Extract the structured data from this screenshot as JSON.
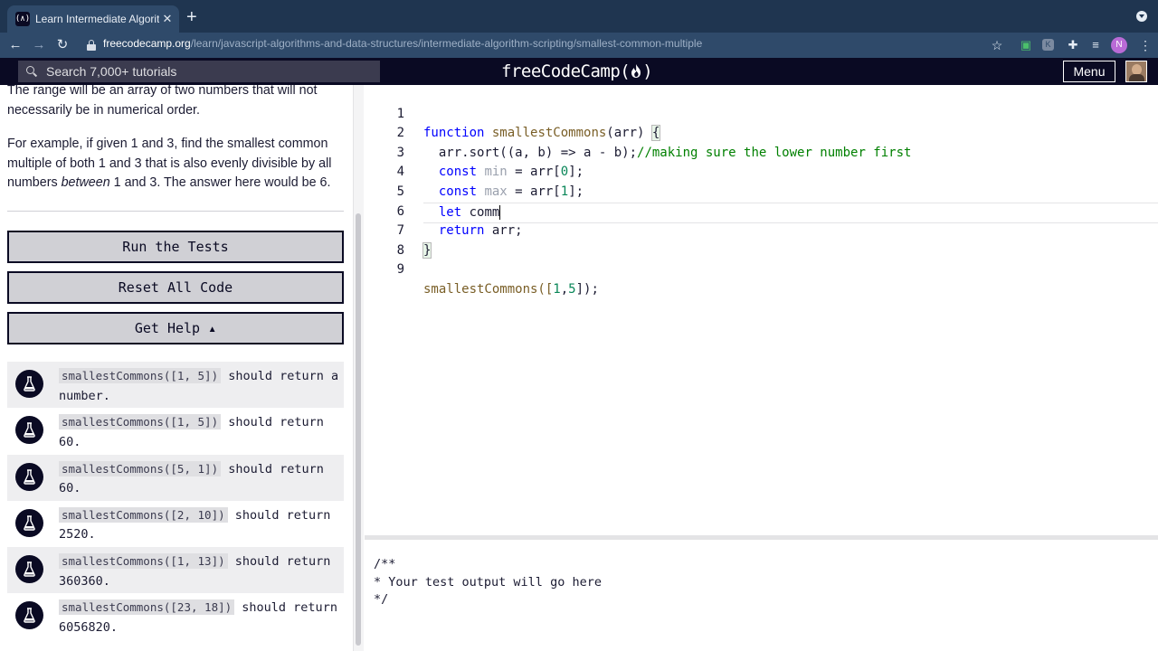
{
  "browser": {
    "tab_title": "Learn Intermediate Algorithm S",
    "favicon_text": "(∧)",
    "url_host": "freecodecamp.org",
    "url_path": "/learn/javascript-algorithms-and-data-structures/intermediate-algorithm-scripting/smallest-common-multiple",
    "profile_initial": "N",
    "icons": [
      "back-arrow-icon",
      "forward-arrow-icon",
      "reload-icon",
      "lock-icon",
      "star-icon",
      "extension-icon",
      "puzzle-icon",
      "reading-list-icon",
      "kebab-menu-icon"
    ]
  },
  "fcc_nav": {
    "search_placeholder": "Search 7,000+ tutorials",
    "brand": "freeCodeCamp(🔥)",
    "brand_text": "freeCodeCamp(",
    "brand_close": ")",
    "menu_label": "Menu"
  },
  "description": {
    "p1": "The range will be an array of two numbers that will not necessarily be in numerical order.",
    "p2_a": "For example, if given 1 and 3, find the smallest common multiple of both 1 and 3 that is also evenly divisible by all numbers ",
    "p2_em": "between",
    "p2_b": " 1 and 3. The answer here would be 6."
  },
  "buttons": {
    "run": "Run the Tests",
    "reset": "Reset All Code",
    "help": "Get Help ▴"
  },
  "tests": [
    {
      "code": "smallestCommons([1, 5])",
      "text": " should return a number."
    },
    {
      "code": "smallestCommons([1, 5])",
      "text": " should return 60."
    },
    {
      "code": "smallestCommons([5, 1])",
      "text": " should return 60."
    },
    {
      "code": "smallestCommons([2, 10])",
      "text": " should return 2520."
    },
    {
      "code": "smallestCommons([1, 13])",
      "text": " should return 360360."
    },
    {
      "code": "smallestCommons([23, 18])",
      "text": " should return 6056820."
    }
  ],
  "editor": {
    "line_numbers": [
      "1",
      "2",
      "3",
      "4",
      "5",
      "6",
      "7",
      "8",
      "9"
    ],
    "l1": {
      "kw": "function",
      "name": " smallestCommons",
      "rest": "(arr) ",
      "brace": "{"
    },
    "l2": {
      "a": "  arr.sort((a, b) => a - b);",
      "comment": "//making sure the lower number first"
    },
    "l3": {
      "kw": "  const",
      "var": " min",
      "mid": " = arr[",
      "num": "0",
      "end": "];"
    },
    "l4": {
      "kw": "  const",
      "var": " max",
      "mid": " = arr[",
      "num": "1",
      "end": "];"
    },
    "l5": {
      "kw": "  let",
      "rest": " comm"
    },
    "l6": {
      "kw": "  return",
      "rest": " arr;"
    },
    "l7": {
      "brace": "}"
    },
    "l9": {
      "a": "smallestCommons([",
      "n1": "1",
      "comma": ",",
      "n2": "5",
      "end": "]);"
    }
  },
  "output": {
    "line1": "/**",
    "line2": "* Your test output will go here",
    "line3": "*/"
  }
}
